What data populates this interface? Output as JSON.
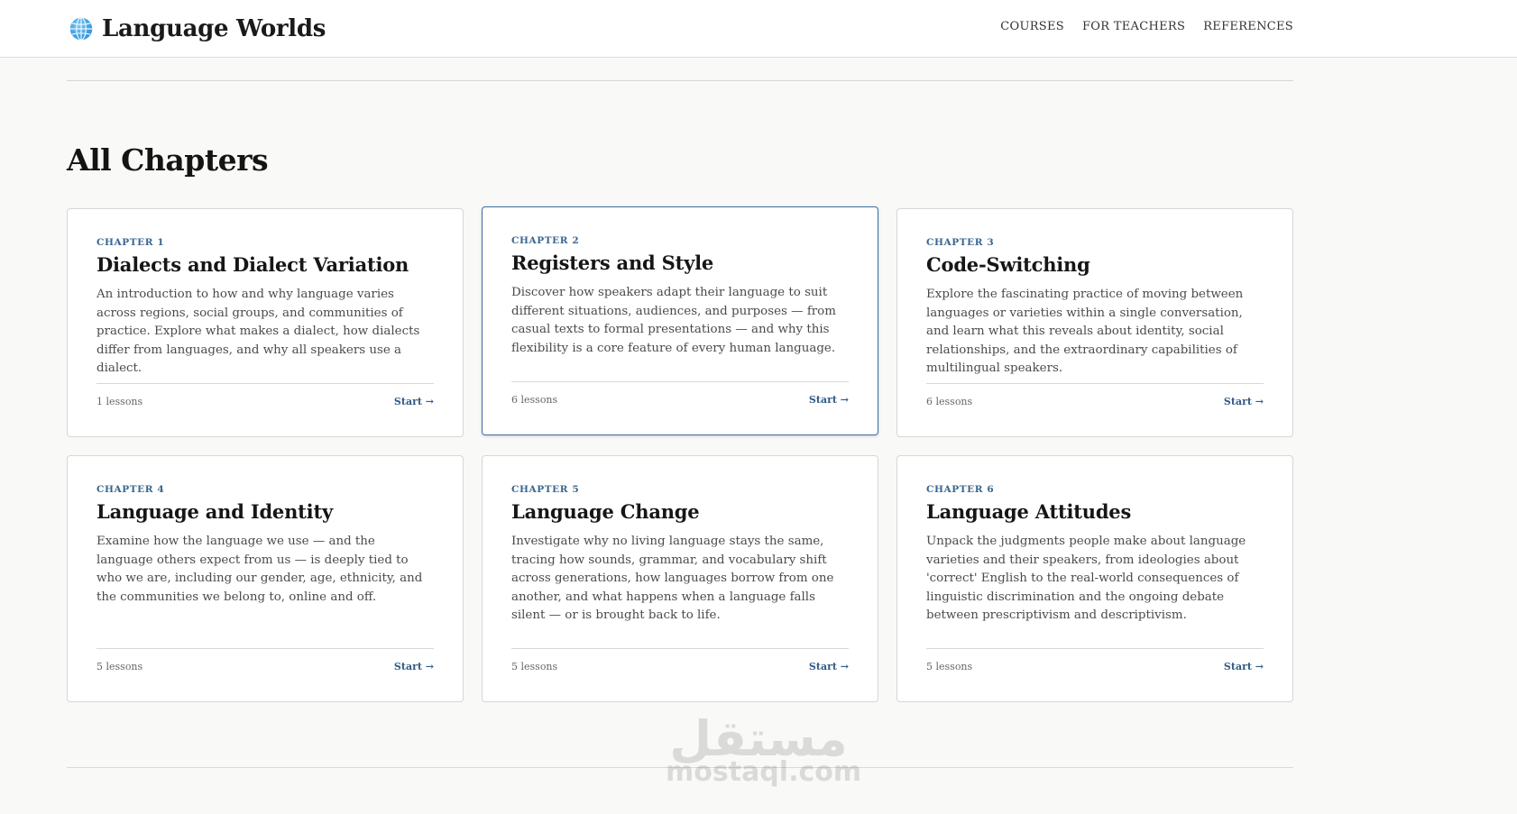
{
  "header": {
    "brand": "Language Worlds",
    "nav": [
      "COURSES",
      "FOR TEACHERS",
      "REFERENCES"
    ]
  },
  "section": {
    "title": "All Chapters"
  },
  "chapters": [
    {
      "label": "CHAPTER 1",
      "title": "Dialects and Dialect Variation",
      "description": "An introduction to how and why language varies across regions, social groups, and communities of practice. Explore what makes a dialect, how dialects differ from languages, and why all speakers use a dialect.",
      "lessons": "1 lessons",
      "action": "Start →"
    },
    {
      "label": "CHAPTER 2",
      "title": "Registers and Style",
      "description": "Discover how speakers adapt their language to suit different situations, audiences, and purposes — from casual texts to formal presentations — and why this flexibility is a core feature of every human language.",
      "lessons": "6 lessons",
      "action": "Start →"
    },
    {
      "label": "CHAPTER 3",
      "title": "Code-Switching",
      "description": "Explore the fascinating practice of moving between languages or varieties within a single conversation, and learn what this reveals about identity, social relationships, and the extraordinary capabilities of multilingual speakers.",
      "lessons": "6 lessons",
      "action": "Start →"
    },
    {
      "label": "CHAPTER 4",
      "title": "Language and Identity",
      "description": "Examine how the language we use — and the language others expect from us — is deeply tied to who we are, including our gender, age, ethnicity, and the communities we belong to, online and off.",
      "lessons": "5 lessons",
      "action": "Start →"
    },
    {
      "label": "CHAPTER 5",
      "title": "Language Change",
      "description": "Investigate why no living language stays the same, tracing how sounds, grammar, and vocabulary shift across generations, how languages borrow from one another, and what happens when a language falls silent — or is brought back to life.",
      "lessons": "5 lessons",
      "action": "Start →"
    },
    {
      "label": "CHAPTER 6",
      "title": "Language Attitudes",
      "description": "Unpack the judgments people make about language varieties and their speakers, from ideologies about 'correct' English to the real-world consequences of linguistic discrimination and the ongoing debate between prescriptivism and descriptivism.",
      "lessons": "5 lessons",
      "action": "Start →"
    }
  ],
  "watermark": {
    "arabic": "مستقل",
    "latin": "mostaql.com"
  },
  "colors": {
    "accent": "#3a6690",
    "link": "#2f5b86",
    "background": "#f9f9f7",
    "card_active_border": "#3c6e9e"
  }
}
